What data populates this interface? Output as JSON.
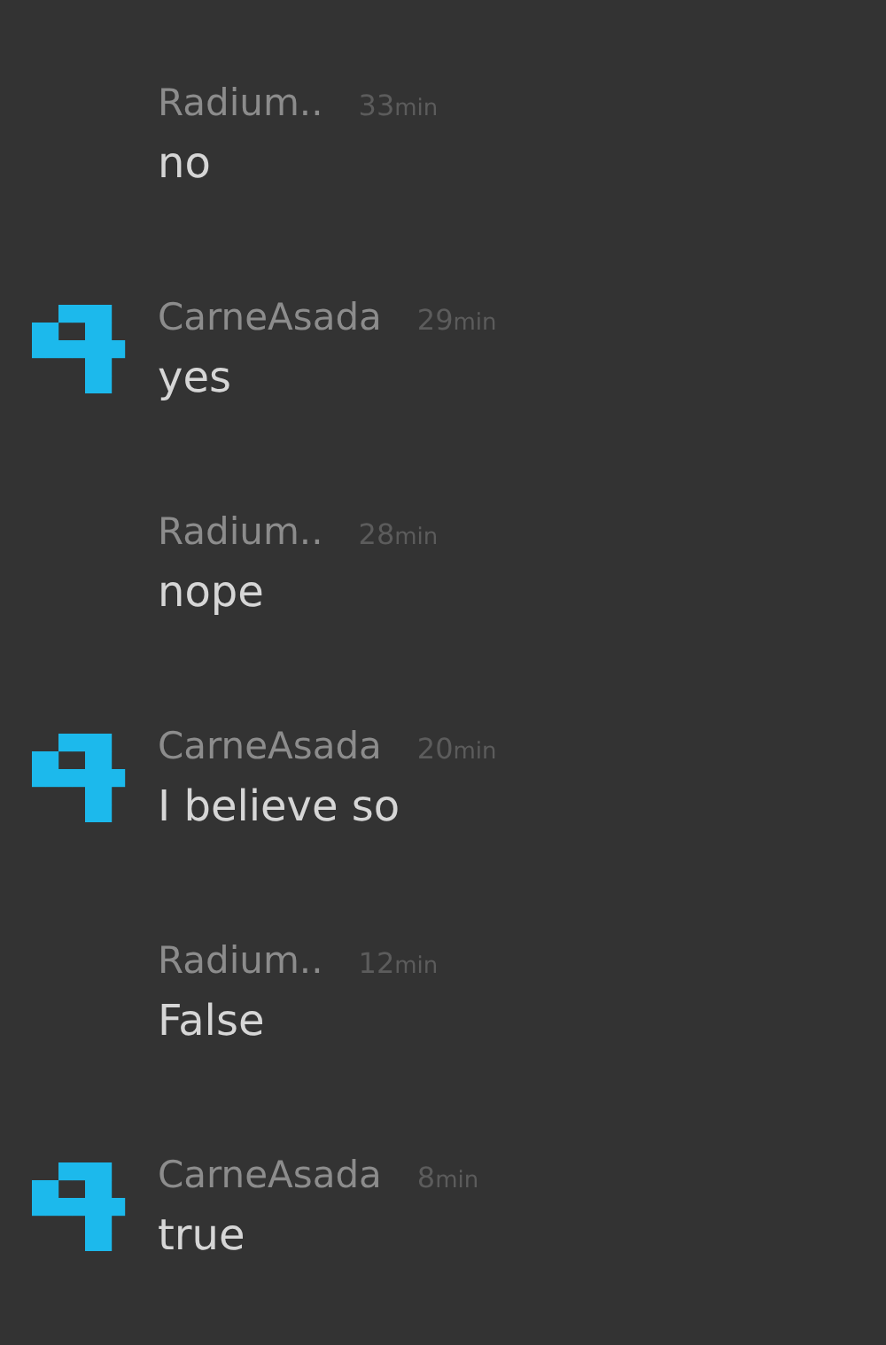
{
  "messages": [
    {
      "avatar": false,
      "author": "Radium..",
      "time": "33",
      "unit": "min",
      "text": "no"
    },
    {
      "avatar": true,
      "author": "CarneAsada",
      "time": "29",
      "unit": "min",
      "text": "yes"
    },
    {
      "avatar": false,
      "author": "Radium..",
      "time": "28",
      "unit": "min",
      "text": "nope"
    },
    {
      "avatar": true,
      "author": "CarneAsada",
      "time": "20",
      "unit": "min",
      "text": "I believe so"
    },
    {
      "avatar": false,
      "author": "Radium..",
      "time": "12",
      "unit": "min",
      "text": "False"
    },
    {
      "avatar": true,
      "author": "CarneAsada",
      "time": "8",
      "unit": "min",
      "text": "true"
    }
  ]
}
